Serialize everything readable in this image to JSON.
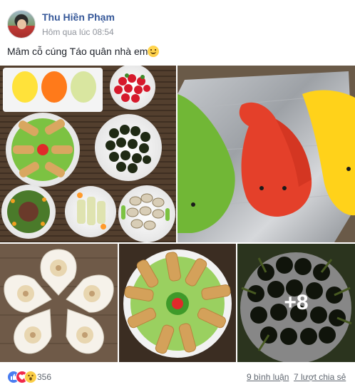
{
  "post": {
    "author": "Thu Hiền Phạm",
    "timestamp": "Hôm qua lúc 08:54",
    "text": "Mâm cỗ cúng Táo quân nhà em",
    "emoji_icon": "smile-icon"
  },
  "photos": {
    "more_count": "+8",
    "items": [
      {
        "subject": "fish-shaped sticky rice, strawberries, spring rolls, snails, salads"
      },
      {
        "subject": "fish-shaped sticky rice on foil"
      },
      {
        "subject": "dumplings in shell dishes"
      },
      {
        "subject": "spring rolls on lettuce plate"
      },
      {
        "subject": "snails"
      }
    ]
  },
  "footer": {
    "reaction_count": "356",
    "comments": "9 bình luận",
    "shares": "7 lượt chia sẻ",
    "reaction_icons": [
      "like-icon",
      "love-icon",
      "wow-icon"
    ]
  },
  "colors": {
    "author_link": "#365899",
    "meta_gray": "#90949c",
    "like_blue": "#4a7df0",
    "love_red": "#f0284a",
    "wow_yellow": "#fbcd46"
  }
}
